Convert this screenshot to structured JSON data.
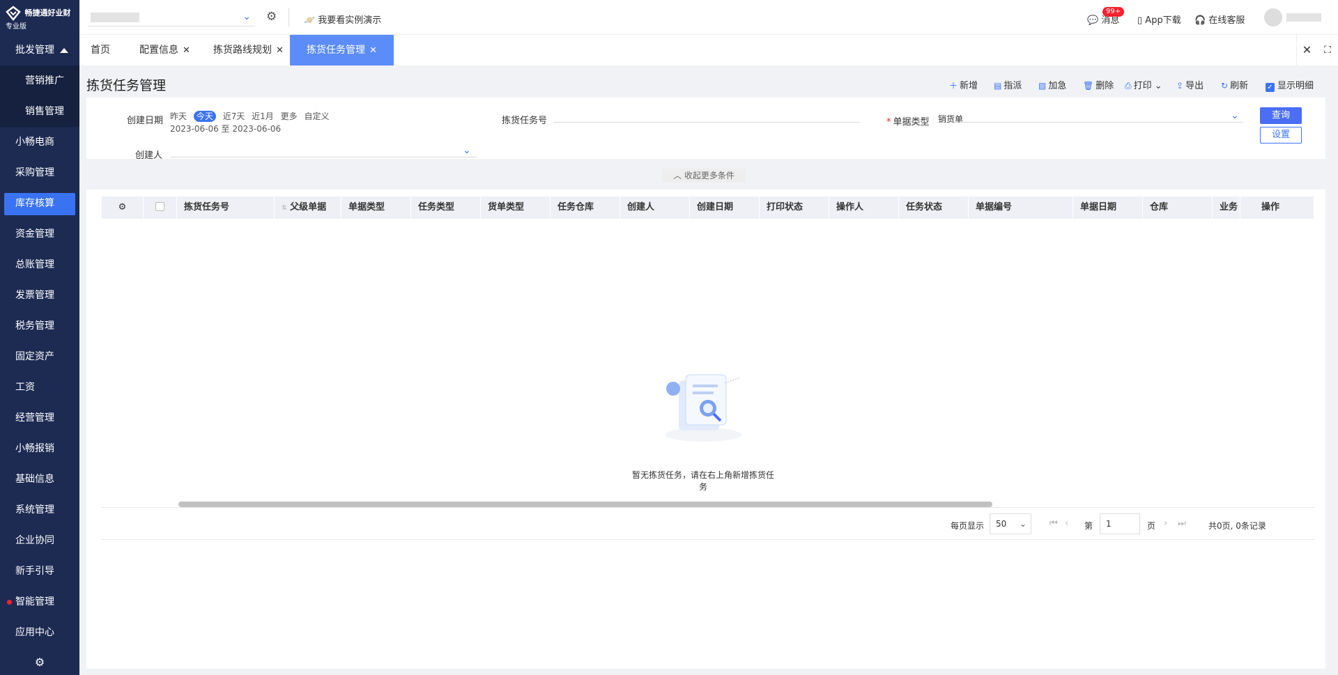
{
  "brand": {
    "name": "畅捷通好业财",
    "edition": "专业版"
  },
  "sidebar": {
    "items": [
      {
        "label": "批发管理",
        "type": "parent"
      },
      {
        "label": "营销推广",
        "type": "sub"
      },
      {
        "label": "销售管理",
        "type": "sub"
      },
      {
        "label": "小畅电商"
      },
      {
        "label": "采购管理"
      },
      {
        "label": "库存核算",
        "active": true
      },
      {
        "label": "资金管理"
      },
      {
        "label": "总账管理"
      },
      {
        "label": "发票管理"
      },
      {
        "label": "税务管理"
      },
      {
        "label": "固定资产"
      },
      {
        "label": "工资"
      },
      {
        "label": "经营管理"
      },
      {
        "label": "小畅报销"
      },
      {
        "label": "基础信息"
      },
      {
        "label": "系统管理"
      },
      {
        "label": "企业协同"
      },
      {
        "label": "新手引导"
      },
      {
        "label": "智能管理",
        "dot": true
      },
      {
        "label": "应用中心"
      }
    ]
  },
  "topbar": {
    "demo_label": "我要看实例演示",
    "messages_label": "消息",
    "messages_badge": "99+",
    "app_label": "App下载",
    "service_label": "在线客服"
  },
  "tabs": [
    {
      "label": "首页"
    },
    {
      "label": "配置信息"
    },
    {
      "label": "拣货路线规划"
    },
    {
      "label": "拣货任务管理",
      "active": true
    }
  ],
  "page": {
    "title": "拣货任务管理"
  },
  "toolbar": {
    "add": "新增",
    "assign": "指派",
    "urgent": "加急",
    "delete": "删除",
    "print": "打印",
    "export": "导出",
    "refresh": "刷新",
    "show_detail": "显示明细"
  },
  "filter": {
    "create_date_label": "创建日期",
    "quick_dates": [
      "昨天",
      "今天",
      "近7天",
      "近1月",
      "更多",
      "自定义"
    ],
    "date_range": "2023-06-06 至 2023-06-06",
    "task_no_label": "拣货任务号",
    "doc_type_label": "单据类型",
    "doc_type_value": "销货单",
    "creator_label": "创建人",
    "query": "查询",
    "settings": "设置",
    "collapse": "收起更多条件"
  },
  "table": {
    "columns": [
      "拣货任务号",
      "父级单据",
      "单据类型",
      "任务类型",
      "货单类型",
      "任务仓库",
      "创建人",
      "创建日期",
      "打印状态",
      "操作人",
      "任务状态",
      "单据编号",
      "单据日期",
      "仓库",
      "业务",
      "操作"
    ],
    "empty_text": "暂无拣货任务，请在右上角新增拣货任务"
  },
  "pagination": {
    "per_page_label": "每页显示",
    "per_page": "50",
    "page_prefix": "第",
    "page": "1",
    "page_suffix": "页",
    "summary": "共0页, 0条记录"
  },
  "colors": {
    "sidebar": "#1d2b53",
    "accent": "#3a73f2",
    "tab_active": "#5b8cf7"
  }
}
